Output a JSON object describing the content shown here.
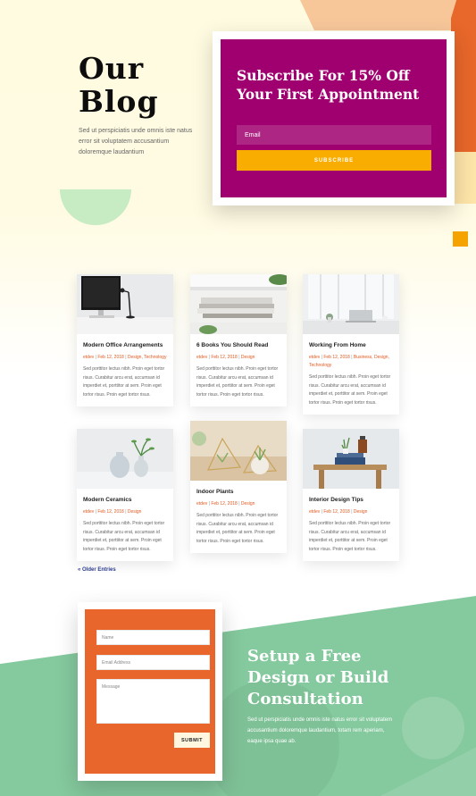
{
  "hero": {
    "title": "Our Blog",
    "description": "Sed ut perspiciatis unde omnis iste natus error sit voluptatem accusantium doloremque laudantium"
  },
  "subscribe": {
    "title": "Subscribe For 15% Off Your First Appointment",
    "email_placeholder": "Email",
    "button_label": "SUBSCRIBE"
  },
  "posts": [
    {
      "title": "Modern Office Arrangements",
      "author": "etdev",
      "date": "Feb 12, 2018",
      "categories": "Design, Technology",
      "excerpt": "Sed porttitor lectus nibh. Proin eget tortor risus. Curabitur arcu erat, accumsan id imperdiet et, porttitor at sem. Proin eget tortor risus. Proin eget tortor risus."
    },
    {
      "title": "6 Books You Should Read",
      "author": "etdev",
      "date": "Feb 12, 2018",
      "categories": "Design",
      "excerpt": "Sed porttitor lectus nibh. Proin eget tortor risus. Curabitur arcu erat, accumsan id imperdiet et, porttitor at sem. Proin eget tortor risus. Proin eget tortor risus."
    },
    {
      "title": "Working From Home",
      "author": "etdev",
      "date": "Feb 12, 2018",
      "categories": "Business, Design, Technology",
      "excerpt": "Sed porttitor lectus nibh. Proin eget tortor risus. Curabitur arcu erat, accumsan id imperdiet et, porttitor at sem. Proin eget tortor risus. Proin eget tortor risus."
    },
    {
      "title": "Modern Ceramics",
      "author": "etdev",
      "date": "Feb 12, 2018",
      "categories": "Design",
      "excerpt": "Sed porttitor lectus nibh. Proin eget tortor risus. Curabitur arcu erat, accumsan id imperdiet et, porttitor at sem. Proin eget tortor risus. Proin eget tortor risus."
    },
    {
      "title": "Indoor Plants",
      "author": "etdev",
      "date": "Feb 12, 2018",
      "categories": "Design",
      "excerpt": "Sed porttitor lectus nibh. Proin eget tortor risus. Curabitur arcu erat, accumsan id imperdiet et, porttitor at sem. Proin eget tortor risus. Proin eget tortor risus."
    },
    {
      "title": "Interior Design Tips",
      "author": "etdev",
      "date": "Feb 12, 2018",
      "categories": "Design",
      "excerpt": "Sed porttitor lectus nibh. Proin eget tortor risus. Curabitur arcu erat, accumsan id imperdiet et, porttitor at sem. Proin eget tortor risus. Proin eget tortor risus."
    }
  ],
  "pagination": {
    "older_label": "« Older Entries"
  },
  "contact_form": {
    "name_placeholder": "Name",
    "email_placeholder": "Email Address",
    "message_placeholder": "Message",
    "submit_label": "SUBMIT"
  },
  "consultation": {
    "title": "Setup a Free Design or Build Consultation",
    "description": "Sed ut perspiciatis unde omnis iste natus error sit voluptatem accusantium doloremque laudantium, totam rem aperiam, eaque ipsa quae ab."
  },
  "colors": {
    "subscribe_bg": "#a0006f",
    "subscribe_button": "#f8ad00",
    "meta_accent": "#e05a20",
    "form_bg": "#e8662b",
    "band_green": "#85c99e",
    "link_blue": "#2a3c8e"
  }
}
